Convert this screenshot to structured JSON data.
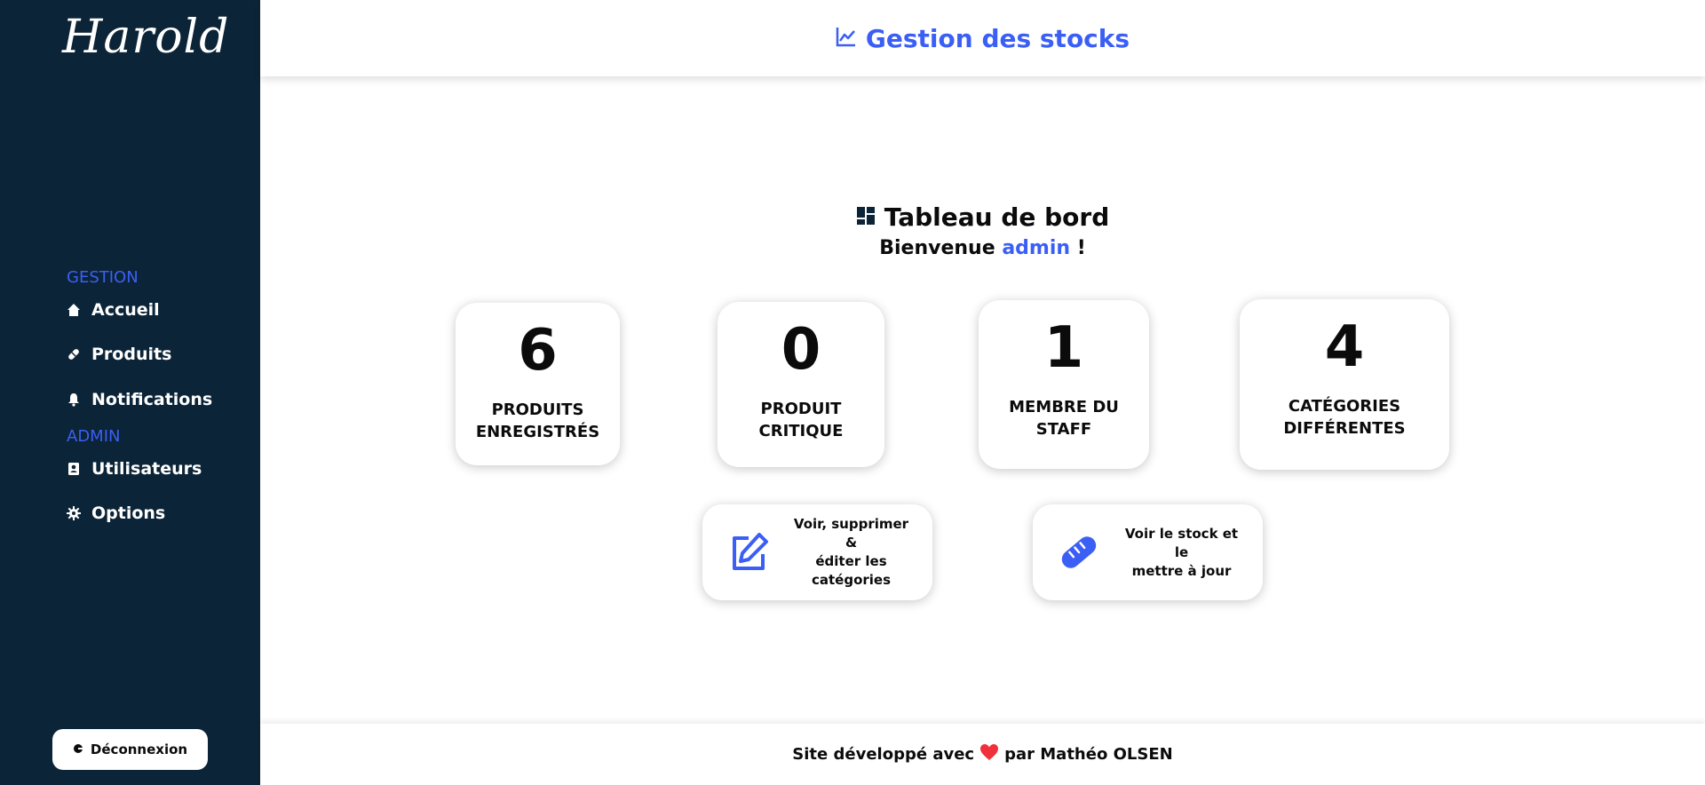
{
  "sidebar": {
    "logo": "Harold",
    "section_gestion": "GESTION",
    "items_gestion": [
      {
        "label": "Accueil",
        "icon": "home-icon"
      },
      {
        "label": "Produits",
        "icon": "pill-icon"
      },
      {
        "label": "Notifications",
        "icon": "bell-icon"
      }
    ],
    "section_admin": "ADMIN",
    "items_admin": [
      {
        "label": "Utilisateurs",
        "icon": "user-card-icon"
      },
      {
        "label": "Options",
        "icon": "gear-icon"
      }
    ],
    "logout_label": "Déconnexion"
  },
  "header": {
    "title": "Gestion des stocks",
    "icon": "line-chart-icon"
  },
  "dashboard": {
    "title": "Tableau de bord",
    "welcome_prefix": "Bienvenue",
    "user": "admin",
    "welcome_suffix": "!",
    "stats": [
      {
        "value": "6",
        "label": "PRODUITS\nENREGISTRÉS"
      },
      {
        "value": "0",
        "label": "PRODUIT\nCRITIQUE"
      },
      {
        "value": "1",
        "label": "MEMBRE DU\nSTAFF"
      },
      {
        "value": "4",
        "label": "CATÉGORIES\nDIFFÉRENTES"
      }
    ],
    "actions": [
      {
        "label": "Voir, supprimer &\néditer les\ncatégories",
        "icon": "edit-icon"
      },
      {
        "label": "Voir le stock et le\nmettre à jour",
        "icon": "bread-icon"
      }
    ]
  },
  "footer": {
    "prefix": "Site développé avec",
    "suffix": "par Mathéo OLSEN",
    "icon": "heart-icon"
  },
  "colors": {
    "sidebar_bg": "#0c2437",
    "accent": "#3b5ff5",
    "heart": "#f0303a"
  }
}
